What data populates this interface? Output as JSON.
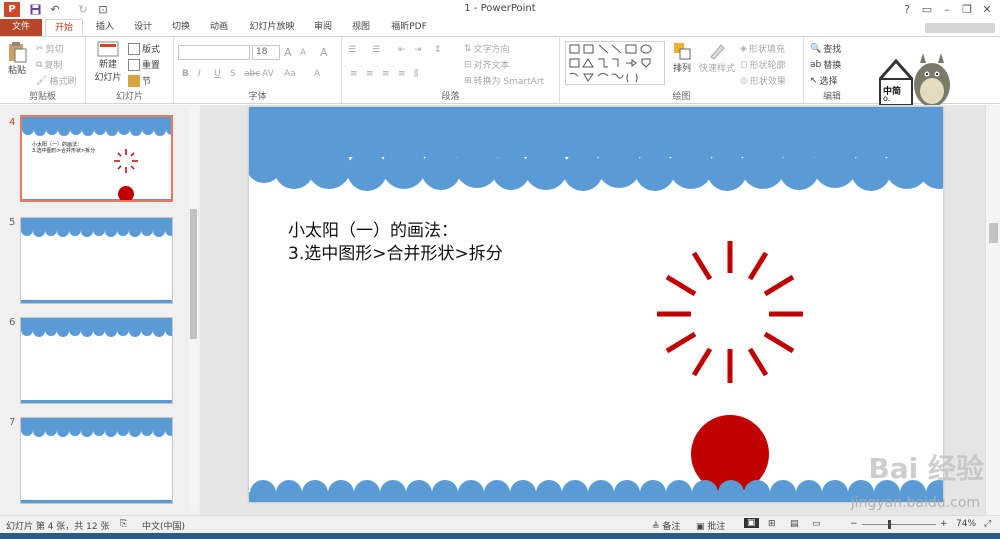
{
  "titlebar": {
    "app_logo": "P",
    "title": "1 - PowerPoint",
    "help": "?",
    "ribbon_opts": "▭",
    "minimize": "–",
    "restore": "❐",
    "close": "✕"
  },
  "qat": {
    "save": "💾",
    "undo": "↶",
    "redo": "↻",
    "present": "⊡"
  },
  "tabs": [
    "文件",
    "开始",
    "插入",
    "设计",
    "切换",
    "动画",
    "幻灯片放映",
    "审阅",
    "视图",
    "福昕PDF"
  ],
  "ribbon": {
    "clipboard": {
      "label": "剪贴板",
      "paste": "粘贴",
      "cut": "剪切",
      "copy": "复制",
      "format_painter": "格式刷"
    },
    "slides": {
      "label": "幻灯片",
      "new_slide": "新建",
      "new_slide2": "幻灯片",
      "layout": "版式",
      "reset": "重置",
      "section": "节"
    },
    "font": {
      "label": "字体",
      "font_name": "",
      "font_size": "18",
      "grow": "A",
      "shrink": "A",
      "clear": "A",
      "bold": "B",
      "italic": "I",
      "underline": "U",
      "shadow": "S",
      "strike": "abc",
      "spacing": "AV",
      "case": "Aa",
      "color": "A"
    },
    "paragraph": {
      "label": "段落",
      "text_direction": "文字方向",
      "align_text": "对齐文本",
      "smartart": "转换为 SmartArt"
    },
    "drawing": {
      "label": "绘图",
      "arrange": "排列",
      "quick_styles": "快速样式",
      "shape_fill": "形状填充",
      "shape_outline": "形状轮廓",
      "shape_effects": "形状效果"
    },
    "editing": {
      "label": "编辑",
      "find": "查找",
      "replace": "替换",
      "select": "选择"
    }
  },
  "sticker": {
    "text": "中简",
    "sub": "o."
  },
  "thumbnails": [
    {
      "num": "4",
      "selected": true,
      "line1": "小太阳（一）的画法：",
      "line2": "3.选中图形>合并形状>拆分"
    },
    {
      "num": "5",
      "selected": false
    },
    {
      "num": "6",
      "selected": false
    },
    {
      "num": "7",
      "selected": false
    }
  ],
  "slide": {
    "line1": "小太阳（一）的画法：",
    "line2": "3.选中图形>合并形状>拆分"
  },
  "colors": {
    "cloud_blue": "#5b9bd5",
    "sun_red": "#c00000",
    "accent": "#b7472a"
  },
  "watermark": {
    "brand": "Bai 经验",
    "url": "jingyan.baidu.com"
  },
  "status": {
    "slide_info": "幻灯片 第 4 张，共 12 张",
    "language": "中文(中国)",
    "notes": "备注",
    "comments": "批注",
    "zoom": "74%"
  }
}
